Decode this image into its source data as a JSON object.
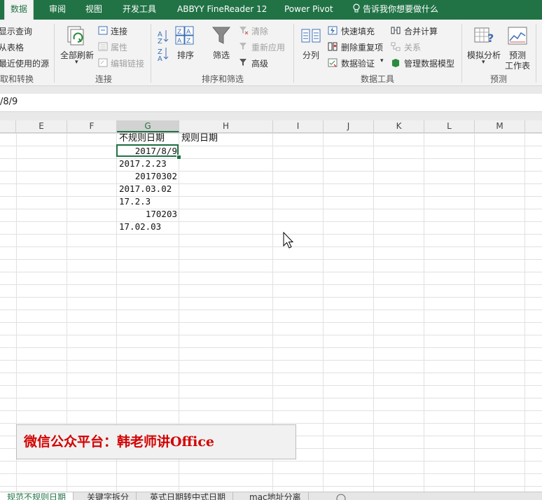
{
  "tabs": {
    "data": "数据",
    "review": "审阅",
    "view": "视图",
    "developer": "开发工具",
    "abbyy": "ABBYY FineReader 12",
    "powerpivot": "Power Pivot",
    "tellme": "告诉我你想要做什么"
  },
  "ribbon": {
    "get_transform": {
      "show_queries": "显示查询",
      "from_table": "从表格",
      "recent_sources": "最近使用的源",
      "group_label": "获取和转换"
    },
    "connections": {
      "refresh_all": "全部刷新",
      "connections": "连接",
      "properties": "属性",
      "edit_links": "编辑链接",
      "group_label": "连接"
    },
    "sort_filter": {
      "sort": "排序",
      "filter": "筛选",
      "clear": "清除",
      "reapply": "重新应用",
      "advanced": "高级",
      "group_label": "排序和筛选"
    },
    "data_tools": {
      "text_to_columns": "分列",
      "flash_fill": "快速填充",
      "remove_duplicates": "删除重复项",
      "data_validation": "数据验证",
      "consolidate": "合并计算",
      "relationships": "关系",
      "manage_data_model": "管理数据模型",
      "group_label": "数据工具"
    },
    "forecast": {
      "what_if": "模拟分析",
      "forecast_sheet_1": "预测",
      "forecast_sheet_2": "工作表",
      "group_label": "预测"
    }
  },
  "formula_bar": {
    "value": "/8/9"
  },
  "columns": [
    "E",
    "F",
    "G",
    "H",
    "I",
    "J",
    "K",
    "L",
    "M"
  ],
  "cells": {
    "g1": "不规则日期",
    "h1": "规则日期",
    "g2": "2017/8/9",
    "g3": "2017.2.23",
    "g4": "20170302",
    "g5": "2017.03.02",
    "g6": "17.2.3",
    "g7": "170203",
    "g8": "17.02.03"
  },
  "watermark": "微信公众平台：韩老师讲Office",
  "sheets": [
    "规范不规则日期",
    "关键字拆分",
    "英式日期转中式日期",
    "mac地址分离"
  ],
  "colors": {
    "accent": "#217346",
    "watermark": "#d40000"
  }
}
